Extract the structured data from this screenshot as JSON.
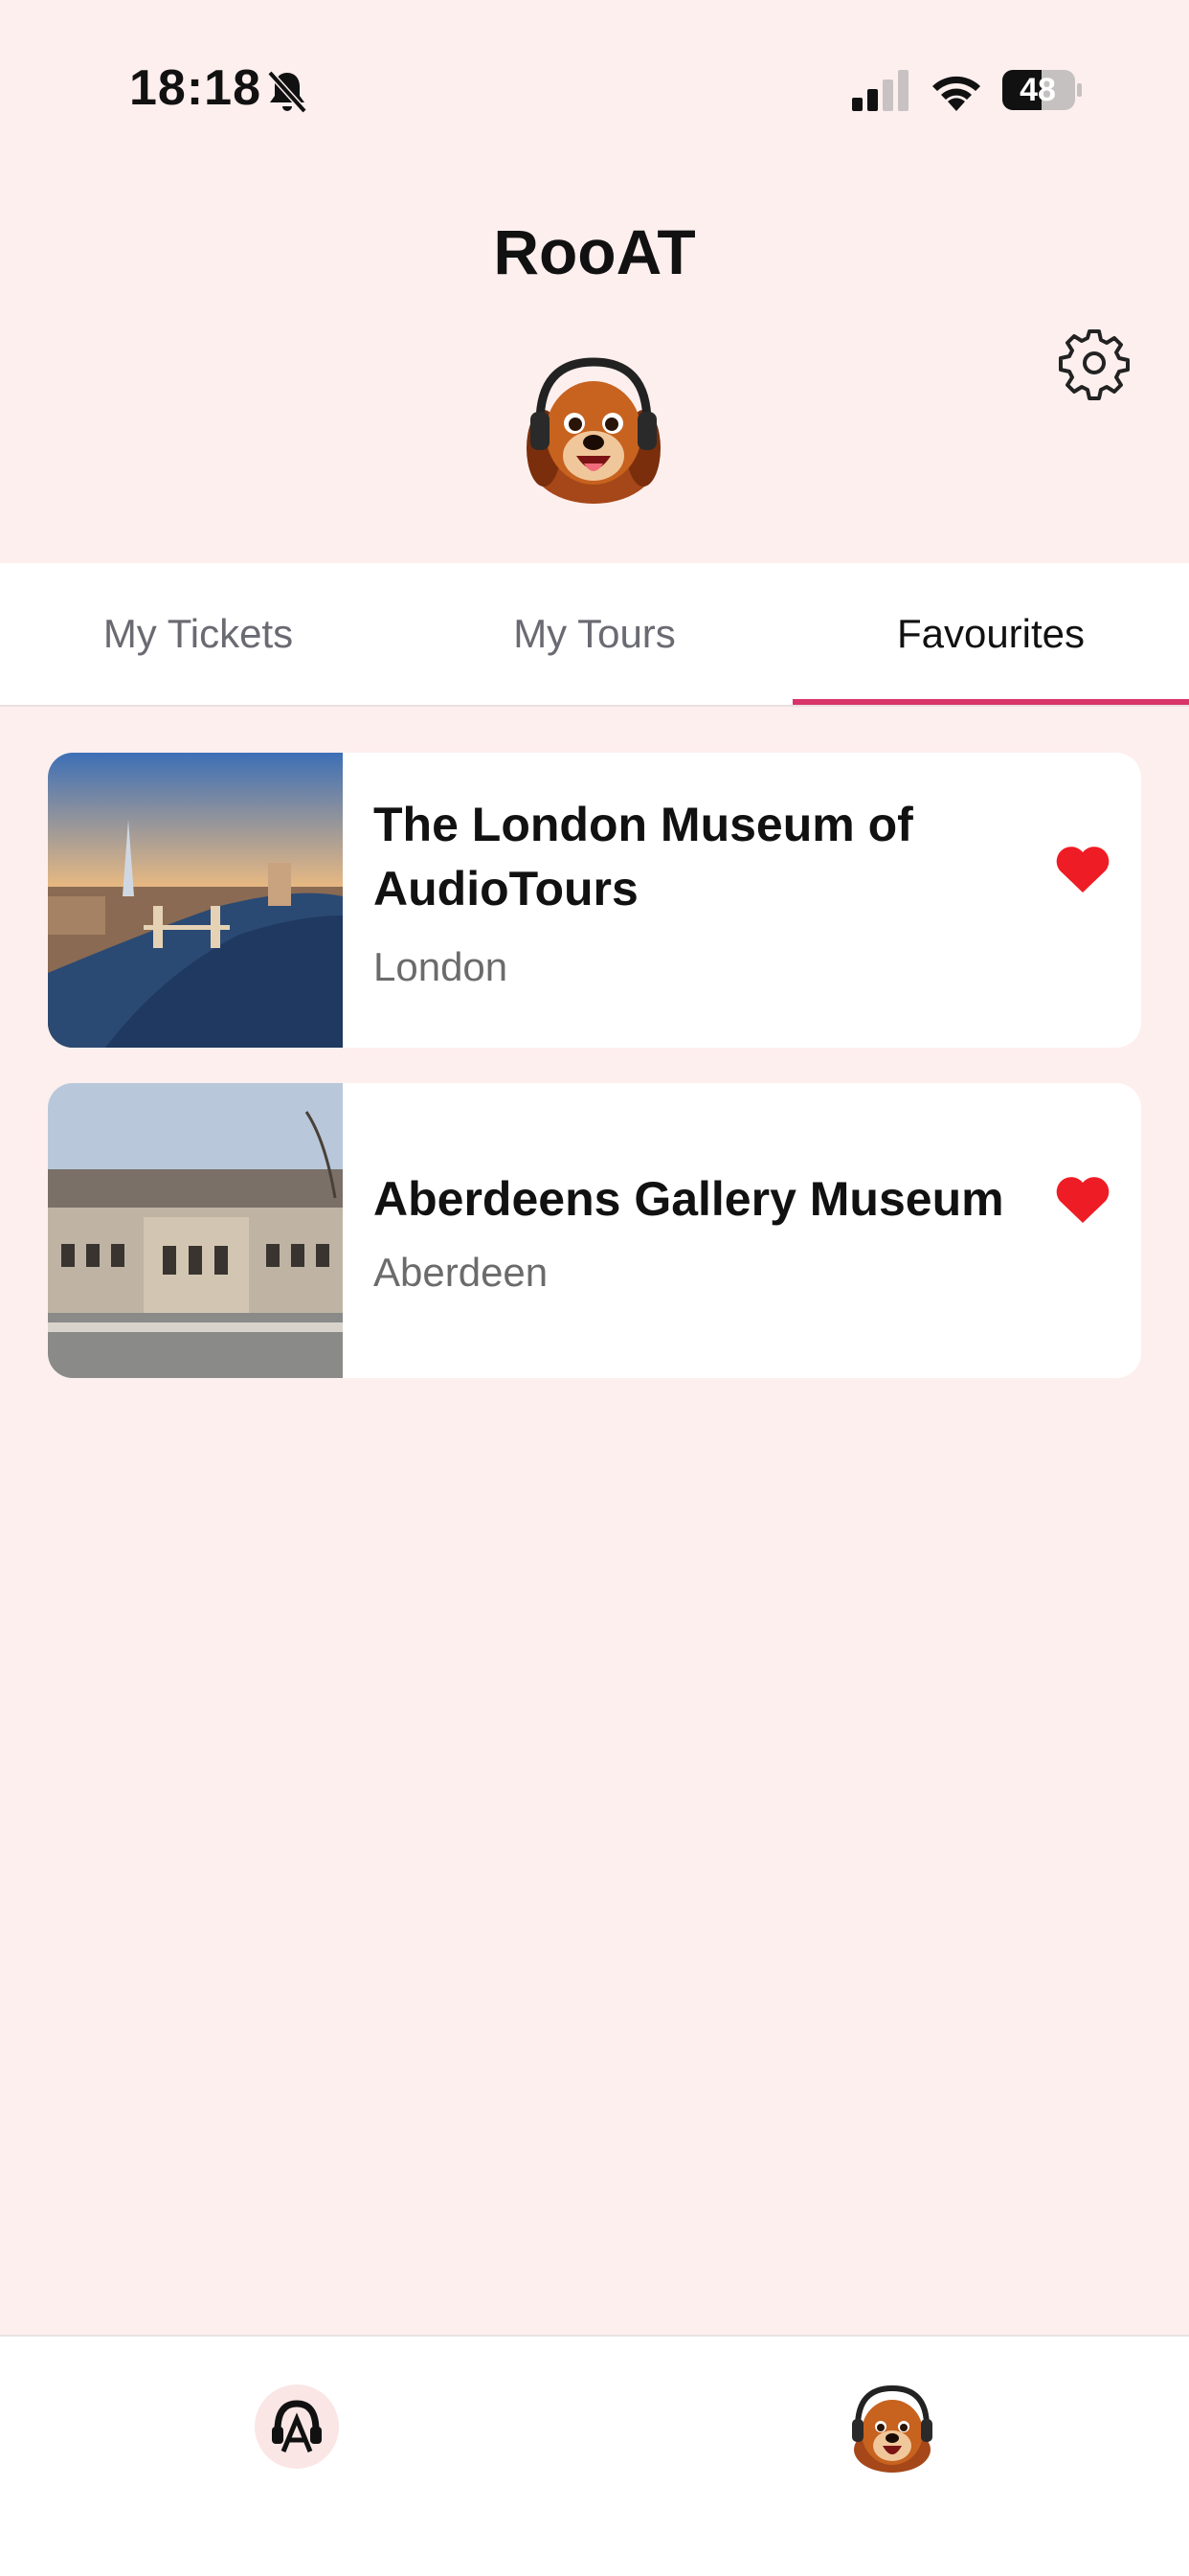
{
  "status_bar": {
    "time": "18:18",
    "battery": "48",
    "icons": [
      "bell-slash-icon",
      "cellular-signal-icon",
      "wifi-icon",
      "battery-icon"
    ]
  },
  "header": {
    "title": "RooAT",
    "settings_icon": "gear-icon",
    "avatar": "dog-headphones-mascot"
  },
  "tabs": [
    {
      "label": "My Tickets",
      "active": false
    },
    {
      "label": "My Tours",
      "active": false
    },
    {
      "label": "Favourites",
      "active": true
    }
  ],
  "favourites": [
    {
      "title": "The London Museum of AudioTours",
      "location": "London",
      "favourite": true,
      "image": "london-tower-bridge-aerial"
    },
    {
      "title": "Aberdeens Gallery Museum",
      "location": "Aberdeen",
      "favourite": true,
      "image": "aberdeen-gallery-building"
    }
  ],
  "bottom_nav": [
    {
      "icon": "headphones-logo-icon"
    },
    {
      "icon": "dog-avatar-icon"
    }
  ],
  "colors": {
    "background": "#fdefee",
    "accent": "#d8346a",
    "heart": "#ee1c24"
  }
}
